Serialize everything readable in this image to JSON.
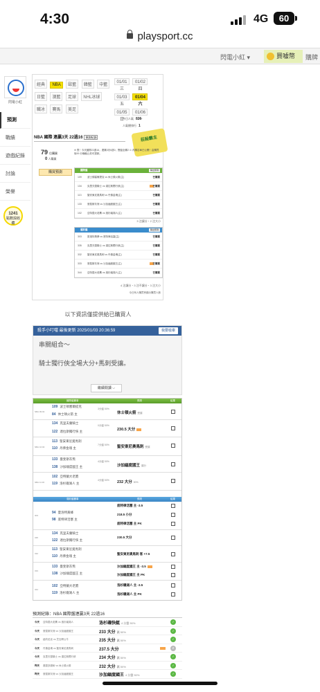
{
  "status_bar": {
    "time": "4:30",
    "network": "4G",
    "battery": "60"
  },
  "browser": {
    "url": "playsport.cc"
  },
  "top_nav": {
    "user": "閃電小紅 ▾",
    "buy": "買噱幣",
    "buy2": "購牌"
  },
  "sidebar": {
    "name": "閃電小紅",
    "items": [
      "預測",
      "戰績",
      "遊戲紀錄",
      "討論",
      "榮譽"
    ],
    "circle_value": "1241",
    "circle_label": "點數與收藏"
  },
  "leagues": [
    "經典",
    "NBA",
    "歐籃",
    "韓籃",
    "中籃",
    "日籃",
    "澳籃",
    "足球",
    "NHL冰球",
    "職冰",
    "賽馬",
    "美足"
  ],
  "days": [
    "01/01 三",
    "01/02 四",
    "01/03 五",
    "01/04 六",
    "01/05 日",
    "01/06 一"
  ],
  "stats": {
    "today_label": "今日人氣",
    "today_value": "826",
    "total_label": "人氣總排行",
    "total_value": "1"
  },
  "badge": {
    "text": "莊殺霸主"
  },
  "panel_title": {
    "title": "NBA 國際 連贏3天 22過16",
    "tag": "預測紀錄"
  },
  "left_count": {
    "value": "79",
    "unit": "位購買",
    "sub_value": "0",
    "sub_label": "人購買"
  },
  "predict_button": "購買預測",
  "note": "※ 賣！今天國際22過16，連贏3天6過0，實盤全贏2 ⊙ 內購名單已公開！由購買後59 分鐘截止前可退款。",
  "table1": {
    "head": "國際盤",
    "head_btn": "購出預測",
    "rows": [
      {
        "id": "109",
        "match": "波士頓塞爾提克 vs 休士頓火箭(主)",
        "status": "已購買"
      },
      {
        "id": "134",
        "match": "克里夫蘭騎士 vs 達拉斯獨行俠(主)",
        "status": "已購買"
      },
      {
        "id": "113",
        "match": "聖安東尼奧馬刺 vs 丹佛金塊(主)",
        "status": "已購買"
      },
      {
        "id": "133",
        "match": "曼斐斯灰熊 vs 沙加緬度國王(主)",
        "status": "已購買"
      },
      {
        "id": "102",
        "match": "亞特蘭大老鷹 vs 洛杉磯湖人(主)",
        "status": "已購買"
      }
    ],
    "footer": "3 注讓分・2 注大小"
  },
  "table2": {
    "head": "運彩盤",
    "head_btn": "購出預測",
    "rows": [
      {
        "id": "303",
        "match": "夏洛特黃蜂 vs 底特律活塞(主)",
        "status": "已購買"
      },
      {
        "id": "335",
        "match": "克里夫蘭騎士 vs 達拉斯獨行俠(主)",
        "status": "已購買"
      },
      {
        "id": "332",
        "match": "聖安東尼奧馬刺 vs 丹佛金塊(主)",
        "status": "已購買"
      },
      {
        "id": "333",
        "match": "曼斐斯灰熊 vs 沙加緬度國王(主)",
        "status": "已購買"
      },
      {
        "id": "344",
        "match": "亞特蘭大老鷹 vs 洛杉磯湖人(主)",
        "status": "已購買"
      }
    ],
    "footer": "4 注讓分・3 注不讓分・3 注大小",
    "footer2": "今日有人購買會顯示購買人數"
  },
  "section_title": "以下資訊僅提供給已購買人",
  "analysis": {
    "author": "殺手小叮噹 最後更新 2025/01/03 20:36:59",
    "button": "我要檢舉",
    "line1": "串關組合～",
    "line2": "騎士獨行俠全場大分+馬刺受讓。",
    "more": "繼續閱讀 ⌵"
  },
  "table3": {
    "head_game": "國際盤賽事",
    "head_pick": "預測",
    "head_result": "結果",
    "rows": [
      {
        "league": "NBA 09:00",
        "teams": [
          {
            "no": "109",
            "name": "波士頓塞爾提克"
          },
          {
            "no": "84",
            "name": "休士頓火箭 主"
          }
        ],
        "meta": "3分盤 50%",
        "pick": "休士頓火箭",
        "sub": "受讓"
      },
      {
        "league": "",
        "teams": [
          {
            "no": "134",
            "name": "克里夫蘭騎士"
          },
          {
            "no": "122",
            "name": "達拉斯獨行俠 主"
          }
        ],
        "meta": "0分盤 50%",
        "pick": "230.5 大分",
        "sub": ""
      },
      {
        "league": "NBA 10:00",
        "teams": [
          {
            "no": "113",
            "name": "聖安東尼奧馬刺"
          },
          {
            "no": "110",
            "name": "丹佛金塊 主"
          }
        ],
        "meta": "7分盤 50%",
        "pick": "聖安東尼奧馬刺",
        "sub": "受讓"
      },
      {
        "league": "",
        "teams": [
          {
            "no": "133",
            "name": "曼斐斯灰熊"
          },
          {
            "no": "138",
            "name": "沙加緬度國王 主"
          }
        ],
        "meta": "4分盤 50%",
        "pick": "沙加緬度國王",
        "sub": "讓分"
      },
      {
        "league": "NBA 11:30",
        "teams": [
          {
            "no": "102",
            "name": "亞特蘭大老鷹"
          },
          {
            "no": "119",
            "name": "洛杉磯湖人 主"
          }
        ],
        "meta": "4分盤 50%",
        "pick": "232 大分",
        "sub": "50%"
      }
    ]
  },
  "table4": {
    "head_game": "運彩盤賽事",
    "head_pick": "預測",
    "head_result": "結果",
    "rows": [
      {
        "league": "303",
        "teams": [
          {
            "no": "94",
            "name": "夏洛特黃蜂"
          },
          {
            "no": "98",
            "name": "底特律活塞 主"
          }
        ],
        "picks": [
          "底特律活塞 主 -3.5",
          "218.5 小分",
          "底特律活塞 主 PK"
        ]
      },
      {
        "league": "335",
        "teams": [
          {
            "no": "134",
            "name": "克里夫蘭騎士"
          },
          {
            "no": "122",
            "name": "達拉斯獨行俠 主"
          }
        ],
        "picks": [
          "230.5 大分"
        ]
      },
      {
        "league": "332",
        "teams": [
          {
            "no": "113",
            "name": "聖安東尼奧馬刺"
          },
          {
            "no": "110",
            "name": "丹佛金塊 主"
          }
        ],
        "picks": [
          "聖安東尼奧馬刺 客 +7.5"
        ]
      },
      {
        "league": "333",
        "teams": [
          {
            "no": "133",
            "name": "曼斐斯灰熊"
          },
          {
            "no": "138",
            "name": "沙加緬度國王 主"
          }
        ],
        "picks": [
          "沙加緬度國王 主 -3.5",
          "沙加緬度國王 主 PK"
        ]
      },
      {
        "league": "344",
        "teams": [
          {
            "no": "102",
            "name": "亞特蘭大老鷹"
          },
          {
            "no": "119",
            "name": "洛杉磯湖人 主"
          }
        ],
        "picks": [
          "洛杉磯湖人 主 -3.5",
          "洛杉磯湖人 主 PK"
        ]
      }
    ]
  },
  "prediction_record": {
    "title": "預測紀錄：NBA 國際盤連贏3天 22過16",
    "rows": [
      {
        "day": "今天",
        "game": "亞特蘭大老鷹 vs 洛杉磯湖人",
        "pick": "洛杉磯快艇",
        "sub": "4 分盤 50%",
        "status": "✓"
      },
      {
        "day": "今天",
        "game": "曼斐斯灰熊 vs 沙加緬度國王",
        "pick": "233 大分",
        "sub": "贏 50%",
        "status": "✓"
      },
      {
        "day": "今天",
        "game": "紐約尼克 vs 芝加哥公牛",
        "pick": "235 大分",
        "sub": "贏 50%",
        "status": "✓"
      },
      {
        "day": "今天",
        "game": "丹佛金塊 vs 聖安東尼奧馬刺",
        "pick": "237.5 大分",
        "sub": "",
        "status": "✗"
      },
      {
        "day": "今天",
        "game": "克里夫蘭騎士 vs 達拉斯獨行俠",
        "pick": "234 大分",
        "sub": "贏 50%",
        "status": "✓"
      },
      {
        "day": "昨天",
        "game": "奧蘭多魔術 vs 休士頓火箭",
        "pick": "232 大分",
        "sub": "贏 50%",
        "status": "✓"
      },
      {
        "day": "昨天",
        "game": "曼斐斯灰熊 vs 沙加緬度國王",
        "pick": "沙加緬度國王",
        "sub": "4 分盤 50%",
        "status": "✓"
      }
    ]
  }
}
